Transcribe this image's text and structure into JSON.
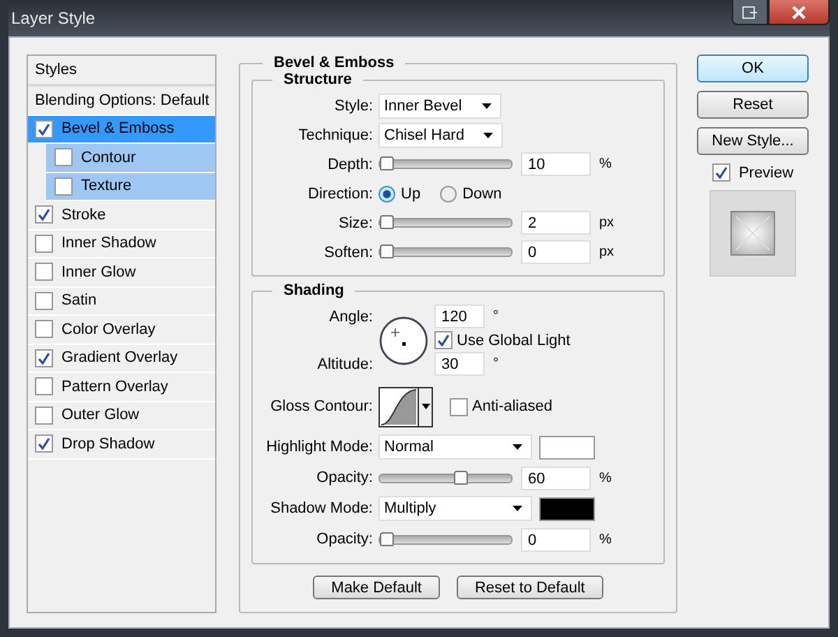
{
  "window": {
    "title": "Layer Style"
  },
  "styles_list": {
    "header": "Styles",
    "items": [
      {
        "label": "Blending Options: Default",
        "kind": "plain",
        "selected": false
      },
      {
        "label": "Bevel & Emboss",
        "kind": "check",
        "checked": true,
        "selected": true,
        "children": [
          {
            "label": "Contour",
            "checked": false
          },
          {
            "label": "Texture",
            "checked": false
          }
        ]
      },
      {
        "label": "Stroke",
        "kind": "check",
        "checked": true,
        "selected": false
      },
      {
        "label": "Inner Shadow",
        "kind": "check",
        "checked": false,
        "selected": false
      },
      {
        "label": "Inner Glow",
        "kind": "check",
        "checked": false,
        "selected": false
      },
      {
        "label": "Satin",
        "kind": "check",
        "checked": false,
        "selected": false
      },
      {
        "label": "Color Overlay",
        "kind": "check",
        "checked": false,
        "selected": false
      },
      {
        "label": "Gradient Overlay",
        "kind": "check",
        "checked": true,
        "selected": false
      },
      {
        "label": "Pattern Overlay",
        "kind": "check",
        "checked": false,
        "selected": false
      },
      {
        "label": "Outer Glow",
        "kind": "check",
        "checked": false,
        "selected": false
      },
      {
        "label": "Drop Shadow",
        "kind": "check",
        "checked": true,
        "selected": false
      }
    ]
  },
  "bevel": {
    "title": "Bevel & Emboss",
    "structure": {
      "title": "Structure",
      "rows": [
        {
          "kind": "dropdown",
          "label": "Style:",
          "value": "Inner Bevel"
        },
        {
          "kind": "dropdown",
          "label": "Technique:",
          "value": "Chisel Hard"
        },
        {
          "kind": "slider",
          "label": "Depth:",
          "level": 0,
          "value": "10",
          "unit": "%"
        },
        {
          "kind": "radio",
          "label": "Direction:",
          "options": [
            {
              "label": "Up",
              "selected": true
            },
            {
              "label": "Down",
              "selected": false
            }
          ]
        },
        {
          "kind": "slider",
          "label": "Size:",
          "level": 0,
          "value": "2",
          "unit": "px"
        },
        {
          "kind": "slider",
          "label": "Soften:",
          "level": 0,
          "value": "0",
          "unit": "px"
        }
      ]
    },
    "shading": {
      "title": "Shading",
      "angle": {
        "label": "Angle:",
        "value": "120",
        "unit": "°"
      },
      "global_light": {
        "label": "Use Global Light",
        "checked": true
      },
      "altitude": {
        "label": "Altitude:",
        "value": "30",
        "unit": "°"
      },
      "gloss_contour": {
        "label": "Gloss Contour:"
      },
      "anti_aliased": {
        "label": "Anti-aliased",
        "checked": false
      },
      "rows": [
        {
          "kind": "mode",
          "label": "Highlight Mode:",
          "value": "Normal",
          "color": "#ffffff"
        },
        {
          "kind": "slider",
          "label": "Opacity:",
          "level": 0.62,
          "value": "60",
          "unit": "%"
        },
        {
          "kind": "mode",
          "label": "Shadow Mode:",
          "value": "Multiply",
          "color": "#000000"
        },
        {
          "kind": "slider",
          "label": "Opacity:",
          "level": 0,
          "value": "0",
          "unit": "%"
        }
      ]
    },
    "buttons": [
      "Make Default",
      "Reset to Default"
    ]
  },
  "side_buttons": [
    {
      "label": "OK",
      "selected": true
    },
    {
      "label": "Reset",
      "selected": false
    },
    {
      "label": "New Style...",
      "selected": false
    }
  ],
  "preview": {
    "label": "Preview",
    "checked": true
  }
}
